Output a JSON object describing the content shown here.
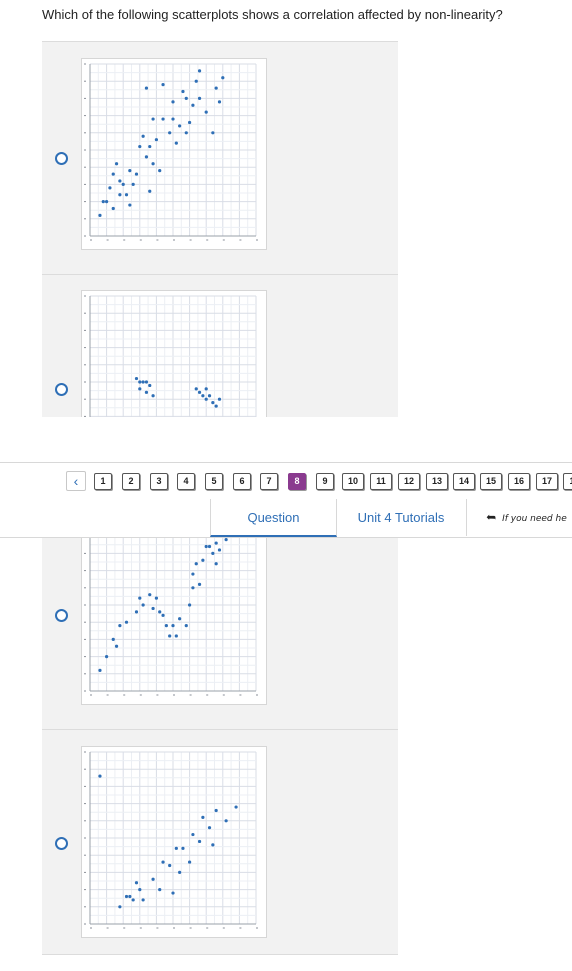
{
  "question": {
    "text": "Which of the following scatterplots shows a correlation affected by non-linearity?"
  },
  "colors": {
    "dot": "#2f6fb6",
    "accent": "#2f6fb6",
    "active_question": "#8a3a8f"
  },
  "nav": {
    "back_icon": "chevron-left",
    "question_numbers": [
      "1",
      "2",
      "3",
      "4",
      "5",
      "6",
      "7",
      "8",
      "9",
      "10",
      "11",
      "12",
      "13",
      "14",
      "15",
      "16",
      "17",
      "1"
    ],
    "active": "8"
  },
  "tabs": {
    "question": "Question",
    "tutorials": "Unit 4 Tutorials",
    "help_icon": "back-arrow",
    "help_text": "If you need he"
  },
  "chart_data": [
    {
      "type": "scatter",
      "option": 1,
      "grid": true,
      "xlim": [
        0,
        50
      ],
      "ylim": [
        0,
        50
      ],
      "points": [
        [
          3,
          6
        ],
        [
          4,
          10
        ],
        [
          5,
          10
        ],
        [
          6,
          14
        ],
        [
          7,
          8
        ],
        [
          7,
          18
        ],
        [
          8,
          21
        ],
        [
          9,
          12
        ],
        [
          9,
          16
        ],
        [
          10,
          15
        ],
        [
          11,
          12
        ],
        [
          12,
          19
        ],
        [
          12,
          9
        ],
        [
          13,
          15
        ],
        [
          14,
          18
        ],
        [
          15,
          26
        ],
        [
          16,
          29
        ],
        [
          17,
          23
        ],
        [
          17,
          43
        ],
        [
          18,
          13
        ],
        [
          18,
          26
        ],
        [
          19,
          21
        ],
        [
          19,
          34
        ],
        [
          20,
          28
        ],
        [
          21,
          19
        ],
        [
          22,
          34
        ],
        [
          22,
          44
        ],
        [
          24,
          30
        ],
        [
          25,
          34
        ],
        [
          25,
          39
        ],
        [
          26,
          27
        ],
        [
          27,
          32
        ],
        [
          28,
          42
        ],
        [
          29,
          40
        ],
        [
          29,
          30
        ],
        [
          30,
          33
        ],
        [
          31,
          38
        ],
        [
          32,
          45
        ],
        [
          33,
          48
        ],
        [
          33,
          40
        ],
        [
          35,
          36
        ],
        [
          37,
          30
        ],
        [
          38,
          43
        ],
        [
          39,
          39
        ],
        [
          40,
          46
        ]
      ]
    },
    {
      "type": "scatter",
      "option": 2,
      "grid": true,
      "xlim": [
        0,
        50
      ],
      "ylim": [
        0,
        50
      ],
      "points": [
        [
          9,
          0
        ],
        [
          11,
          1
        ],
        [
          12,
          3
        ],
        [
          14,
          26
        ],
        [
          15,
          25
        ],
        [
          15,
          23
        ],
        [
          16,
          25
        ],
        [
          17,
          22
        ],
        [
          17,
          25
        ],
        [
          18,
          24
        ],
        [
          19,
          21
        ],
        [
          32,
          23
        ],
        [
          33,
          22
        ],
        [
          34,
          21
        ],
        [
          35,
          20
        ],
        [
          35,
          23
        ],
        [
          36,
          21
        ],
        [
          37,
          19
        ],
        [
          38,
          18
        ],
        [
          39,
          20
        ]
      ]
    },
    {
      "type": "scatter",
      "option": 3,
      "grid": true,
      "xlim": [
        0,
        50
      ],
      "ylim": [
        0,
        50
      ],
      "points": [
        [
          3,
          6
        ],
        [
          5,
          10
        ],
        [
          7,
          15
        ],
        [
          8,
          13
        ],
        [
          9,
          19
        ],
        [
          11,
          20
        ],
        [
          14,
          23
        ],
        [
          15,
          27
        ],
        [
          16,
          25
        ],
        [
          18,
          28
        ],
        [
          19,
          24
        ],
        [
          20,
          27
        ],
        [
          21,
          23
        ],
        [
          22,
          22
        ],
        [
          23,
          19
        ],
        [
          24,
          16
        ],
        [
          25,
          19
        ],
        [
          26,
          16
        ],
        [
          27,
          21
        ],
        [
          29,
          19
        ],
        [
          30,
          25
        ],
        [
          31,
          30
        ],
        [
          31,
          34
        ],
        [
          32,
          37
        ],
        [
          33,
          31
        ],
        [
          34,
          38
        ],
        [
          35,
          42
        ],
        [
          36,
          42
        ],
        [
          37,
          40
        ],
        [
          38,
          43
        ],
        [
          38,
          37
        ],
        [
          39,
          48
        ],
        [
          39,
          41
        ],
        [
          40,
          46
        ],
        [
          41,
          44
        ]
      ]
    },
    {
      "type": "scatter",
      "option": 4,
      "grid": true,
      "xlim": [
        0,
        50
      ],
      "ylim": [
        0,
        50
      ],
      "points": [
        [
          3,
          43
        ],
        [
          9,
          5
        ],
        [
          11,
          8
        ],
        [
          12,
          8
        ],
        [
          13,
          7
        ],
        [
          14,
          12
        ],
        [
          15,
          10
        ],
        [
          16,
          7
        ],
        [
          19,
          13
        ],
        [
          21,
          10
        ],
        [
          22,
          18
        ],
        [
          24,
          17
        ],
        [
          25,
          9
        ],
        [
          26,
          22
        ],
        [
          27,
          15
        ],
        [
          28,
          22
        ],
        [
          30,
          18
        ],
        [
          31,
          26
        ],
        [
          33,
          24
        ],
        [
          34,
          31
        ],
        [
          36,
          28
        ],
        [
          37,
          23
        ],
        [
          38,
          33
        ],
        [
          41,
          30
        ],
        [
          44,
          34
        ]
      ]
    }
  ]
}
